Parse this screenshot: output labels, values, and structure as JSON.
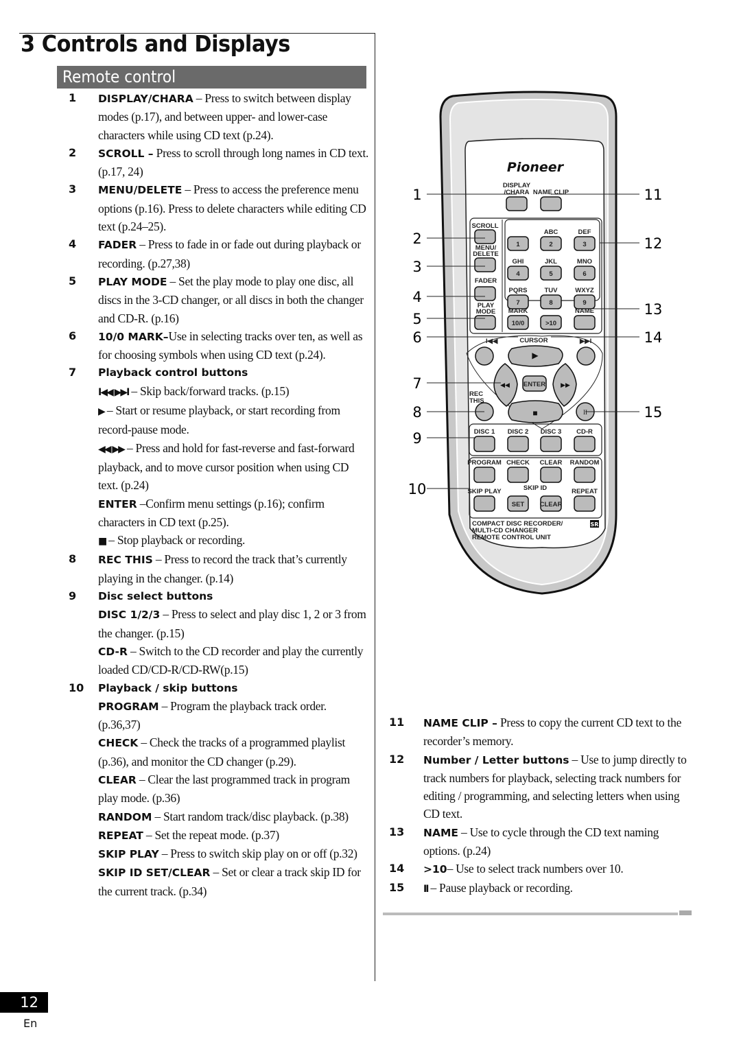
{
  "page": {
    "title": "3 Controls and Displays",
    "section": "Remote control",
    "page_number": "12",
    "language": "En"
  },
  "left_items": [
    {
      "num": "1",
      "entries": [
        {
          "label": "DISPLAY/CHARA",
          "text": " – Press to switch between display modes  (p.17), and between upper- and lower-case characters while using CD text (p.24)."
        }
      ]
    },
    {
      "num": "2",
      "entries": [
        {
          "label": "SCROLL –",
          "text": " Press to scroll through long names in CD text. (p.17, 24)"
        }
      ]
    },
    {
      "num": "3",
      "entries": [
        {
          "label": "MENU/DELETE",
          "text": " – Press to access the preference menu options (p.16). Press to delete characters while editing CD text (p.24–25)."
        }
      ]
    },
    {
      "num": "4",
      "entries": [
        {
          "label": "FADER",
          "text": " – Press to fade in or fade out during playback or recording. (p.27,38)"
        }
      ]
    },
    {
      "num": "5",
      "entries": [
        {
          "label": "PLAY MODE",
          "text": " – Set the play mode to play one disc, all discs in the 3-CD changer, or all discs in both the changer and CD-R. (p.16)"
        }
      ]
    },
    {
      "num": "6",
      "entries": [
        {
          "label": "10/0 MARK–",
          "text": "Use in selecting tracks over ten, as well as for choosing symbols when using CD text (p.24)."
        }
      ]
    },
    {
      "num": "7",
      "heading": "Playback control buttons",
      "entries": [
        {
          "symbol": "I◀◀ ▶▶I",
          "text": "  – Skip back/forward tracks. (p.15)"
        },
        {
          "symbol": "▶",
          "text": " – Start or resume playback, or start recording from record-pause mode."
        },
        {
          "symbol": "◀◀ ▶▶",
          "text": "  – Press and hold for fast-reverse and fast-forward playback, and to move cursor position when using CD text. (p.24)"
        },
        {
          "label": "ENTER",
          "text": " –Confirm menu settings (p.16); confirm characters in CD text (p.25)."
        },
        {
          "symbol": "■",
          "text": " – Stop playback or recording."
        }
      ]
    },
    {
      "num": "8",
      "entries": [
        {
          "label": "REC THIS",
          "text": " – Press to record the track that’s currently playing in the changer. (p.14)"
        }
      ]
    },
    {
      "num": "9",
      "heading": "Disc select buttons",
      "entries": [
        {
          "label": "DISC 1/2/3",
          "text": " – Press to select and play disc 1, 2 or 3 from the changer. (p.15)"
        },
        {
          "label": "CD-R",
          "text": " – Switch to the CD recorder and play the currently loaded CD/CD-R/CD-RW(p.15)"
        }
      ]
    },
    {
      "num": "10",
      "heading": "Playback / skip buttons",
      "entries": [
        {
          "label": "PROGRAM",
          "text": " – Program the playback track order. (p.36,37)"
        },
        {
          "label": "CHECK",
          "text": " – Check the tracks of a programmed playlist (p.36), and monitor the CD changer (p.29)."
        },
        {
          "label": "CLEAR",
          "text": " – Clear the last programmed track in program play mode. (p.36)"
        },
        {
          "label": "RANDOM",
          "text": " – Start random track/disc playback. (p.38)"
        },
        {
          "label": "REPEAT",
          "text": " – Set the repeat mode. (p.37)"
        },
        {
          "label": "SKIP PLAY",
          "text": " – Press to switch skip play on or off (p.32)"
        },
        {
          "label": "SKIP ID SET/CLEAR",
          "text": " – Set or clear a track skip ID for the current track. (p.34)"
        }
      ]
    }
  ],
  "right_items": [
    {
      "num": "11",
      "entries": [
        {
          "label": "NAME CLIP –",
          "text": "  Press to copy the current CD text to the recorder’s memory."
        }
      ]
    },
    {
      "num": "12",
      "entries": [
        {
          "label": "Number / Letter buttons",
          "text": " – Use to jump directly to track numbers for playback, selecting track numbers for editing / programming, and selecting letters when using CD text."
        }
      ]
    },
    {
      "num": "13",
      "entries": [
        {
          "label": "NAME",
          "text": " – Use to cycle through the CD text naming options. (p.24)"
        }
      ]
    },
    {
      "num": "14",
      "entries": [
        {
          "label": ">10",
          "text": "– Use to select track numbers over 10."
        }
      ]
    },
    {
      "num": "15",
      "entries": [
        {
          "symbol": "II",
          "text": " – Pause playback or recording."
        }
      ]
    }
  ],
  "remote": {
    "brand": "Pioneer",
    "labels": {
      "display_chara_1": "DISPLAY",
      "display_chara_2": "/CHARA",
      "name_clip": "NAME CLIP",
      "scroll": "SCROLL",
      "menu": "MENU/",
      "delete": "DELETE",
      "fader": "FADER",
      "play": "PLAY",
      "mode": "MODE",
      "mark": "MARK",
      "name": "NAME",
      "cursor": "CURSOR",
      "enter": "ENTER",
      "rec": "REC",
      "this": "THIS",
      "skip_id": "SKIP ID",
      "set": "SET",
      "clear_small": "CLEAR",
      "footer_1": "COMPACT DISC RECORDER/",
      "footer_2": "MULTI-CD CHANGER",
      "footer_3": "REMOTE CONTROL UNIT",
      "sr": "SR"
    },
    "letters": [
      "",
      "ABC",
      "DEF",
      "GHI",
      "JKL",
      "MNO",
      "PQRS",
      "TUV",
      "WXYZ"
    ],
    "digits": [
      "1",
      "2",
      "3",
      "4",
      "5",
      "6",
      "7",
      "8",
      "9"
    ],
    "mark_key": "10/0",
    "gt10_key": ">10",
    "disc_buttons": [
      "DISC 1",
      "DISC 2",
      "DISC 3",
      "CD-R"
    ],
    "mode_buttons": [
      "PROGRAM",
      "CHECK",
      "CLEAR",
      "RANDOM"
    ],
    "skip_play": "SKIP PLAY",
    "repeat": "REPEAT",
    "callouts_left": [
      "1",
      "2",
      "3",
      "4",
      "5",
      "6",
      "7",
      "8",
      "9",
      "10"
    ],
    "callouts_right": [
      "11",
      "12",
      "13",
      "14",
      "15"
    ]
  }
}
